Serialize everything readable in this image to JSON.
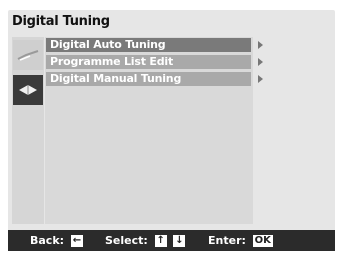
{
  "header": {
    "title": "Digital Tuning"
  },
  "menu": {
    "items": [
      {
        "label": "Digital Auto Tuning"
      },
      {
        "label": "Programme List Edit"
      },
      {
        "label": "Digital Manual Tuning"
      }
    ]
  },
  "sidebar": {
    "icons": [
      {
        "name": "tuning-icon"
      },
      {
        "name": "settings-icon"
      }
    ]
  },
  "footer": {
    "back_label": "Back:",
    "back_key": "←",
    "select_label": "Select:",
    "select_up_key": "↑",
    "select_down_key": "↓",
    "enter_label": "Enter:",
    "enter_key": "OK"
  },
  "colors": {
    "selected_item": "#7a7a7a",
    "item": "#a9a9a9",
    "footer_bg": "#2b2b2b"
  }
}
